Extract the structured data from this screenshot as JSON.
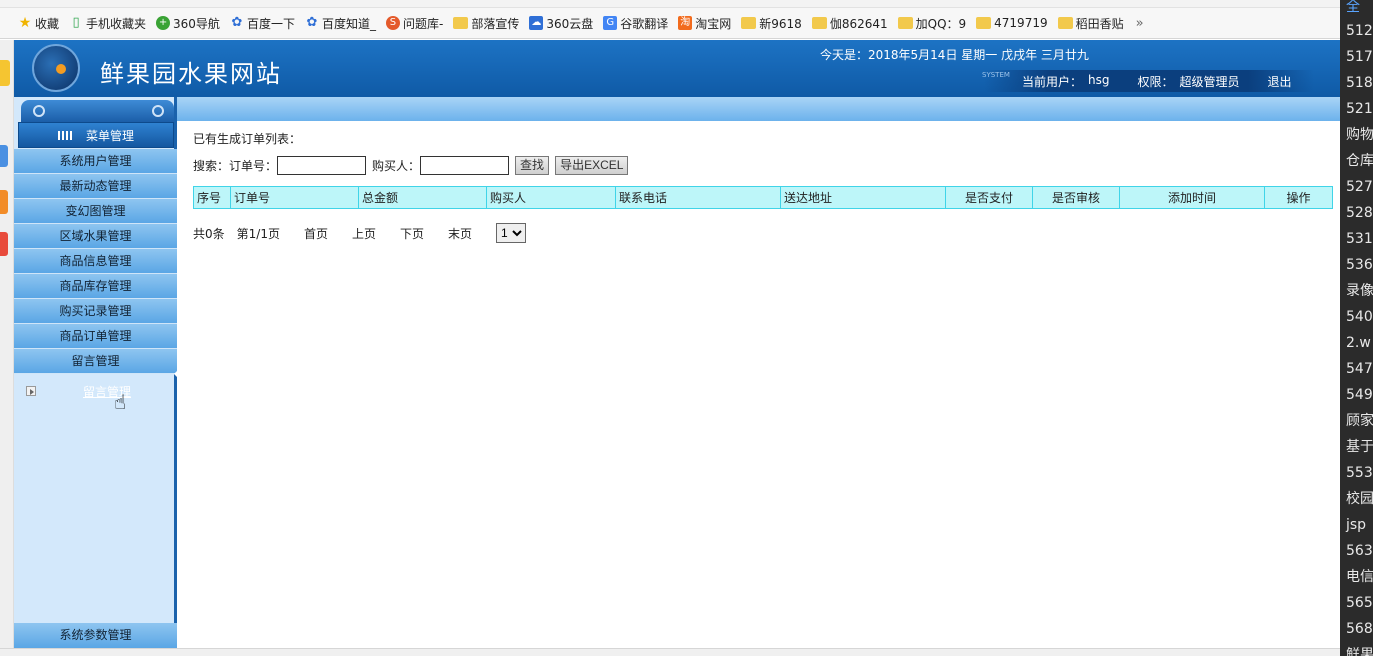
{
  "bookmarks": [
    {
      "label": "收藏",
      "icon": "star-icon"
    },
    {
      "label": "手机收藏夹",
      "icon": "phone-icon"
    },
    {
      "label": "360导航",
      "icon": "nav360-icon"
    },
    {
      "label": "百度一下",
      "icon": "baidu-paw-icon"
    },
    {
      "label": "百度知道_",
      "icon": "baidu-paw-icon"
    },
    {
      "label": "问题库-",
      "icon": "s-icon"
    },
    {
      "label": "部落宣传",
      "icon": "folder-icon"
    },
    {
      "label": "360云盘",
      "icon": "cloud-icon"
    },
    {
      "label": "谷歌翻译",
      "icon": "google-translate-icon"
    },
    {
      "label": "淘宝网",
      "icon": "taobao-icon"
    },
    {
      "label": "新9618",
      "icon": "folder-icon"
    },
    {
      "label": "伽862641",
      "icon": "folder-icon"
    },
    {
      "label": "加QQ：9",
      "icon": "folder-icon"
    },
    {
      "label": "4719719",
      "icon": "folder-icon"
    },
    {
      "label": "稻田香贴",
      "icon": "folder-icon"
    }
  ],
  "bookmarks_more": "»",
  "right_panel": {
    "top": "全",
    "items": [
      "512",
      "517",
      "518",
      "521",
      "购物",
      "仓库",
      "527",
      "528",
      "531",
      "536",
      "录像",
      "540",
      "2.w",
      "547",
      "549",
      "顾家",
      "基于",
      "553",
      "校园",
      "jsp",
      "563",
      "电信",
      "565",
      "568",
      "鲜果"
    ]
  },
  "header": {
    "site_title": "鲜果园水果网站",
    "date_line": "今天是：2018年5月14日 星期一 戊戌年 三月廿九",
    "system_tag": "SYSTEM",
    "current_user_label": "当前用户：",
    "current_user": "hsg",
    "role_label": "权限：",
    "role": "超级管理员",
    "logout": "退出"
  },
  "menu": {
    "title": "菜单管理",
    "items": [
      "系统用户管理",
      "最新动态管理",
      "变幻图管理",
      "区域水果管理",
      "商品信息管理",
      "商品库存管理",
      "购买记录管理",
      "商品订单管理",
      "留言管理"
    ],
    "submenu": "留言管理",
    "bottom": "系统参数管理"
  },
  "content": {
    "section_title": "已有生成订单列表：",
    "search_label": "搜索：",
    "order_no_label": "订单号：",
    "order_no_value": "",
    "buyer_label": "购买人：",
    "buyer_value": "",
    "search_button": "查找",
    "export_button": "导出EXCEL",
    "columns": [
      "序号",
      "订单号",
      "总金额",
      "购买人",
      "联系电话",
      "送达地址",
      "是否支付",
      "是否审核",
      "添加时间",
      "操作"
    ],
    "rows": [],
    "pager": {
      "total": "共0条",
      "page_info": "第1/1页",
      "first": "首页",
      "prev": "上页",
      "next": "下页",
      "last": "末页",
      "page_select": "1"
    }
  }
}
